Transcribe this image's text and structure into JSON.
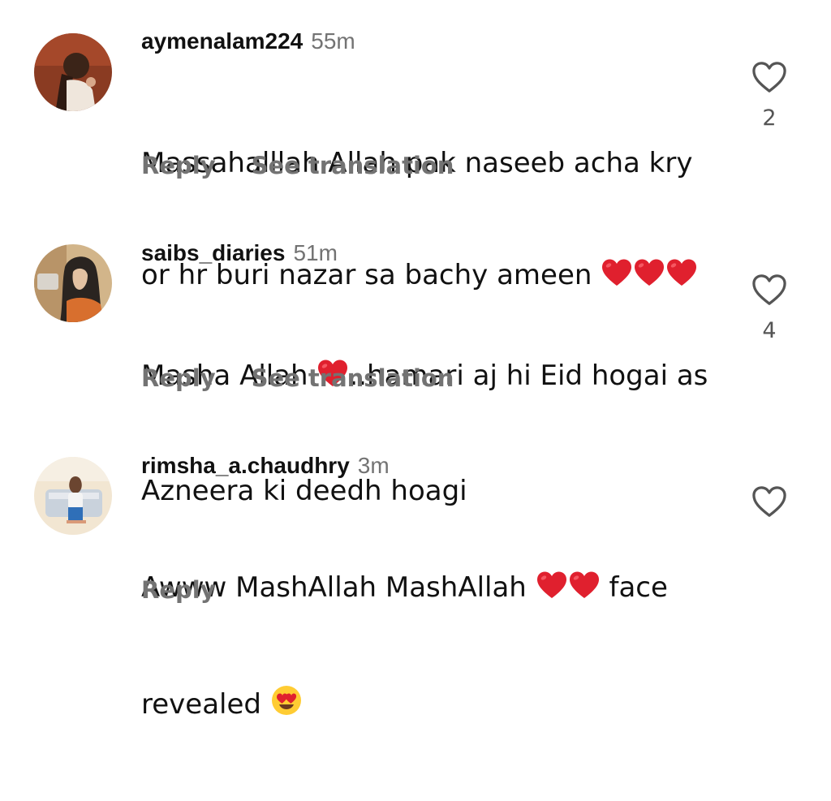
{
  "comments": [
    {
      "username": "aymenalam224",
      "time": "55m",
      "lines": [
        "Massahalllah Allah pak naseeb acha kry",
        "or hr buri nazar sa bachy ameen"
      ],
      "line_emojis": [
        "",
        "red-heart-emoji x3"
      ],
      "reply_label": "Reply",
      "translation_label": "See translation",
      "likes": "2",
      "like_icon": "heart-outline-icon"
    },
    {
      "username": "saibs_diaries",
      "time": "51m",
      "line1_before": "Masha Allah ",
      "line1_after": "..hamari aj hi Eid hogai as",
      "line2": "Azneera ki deedh hoagi",
      "reply_label": "Reply",
      "translation_label": "See translation",
      "likes": "4",
      "like_icon": "heart-outline-icon"
    },
    {
      "username": "rimsha_a.chaudhry",
      "time": "3m",
      "line1_before": "Awww MashAllah MashAllah ",
      "line1_after": " face",
      "line2": "revealed ",
      "reply_label": "Reply",
      "like_icon": "heart-outline-icon"
    }
  ],
  "colors": {
    "text": "#111111",
    "muted": "#737373",
    "heart_emoji": "#e0202e"
  }
}
